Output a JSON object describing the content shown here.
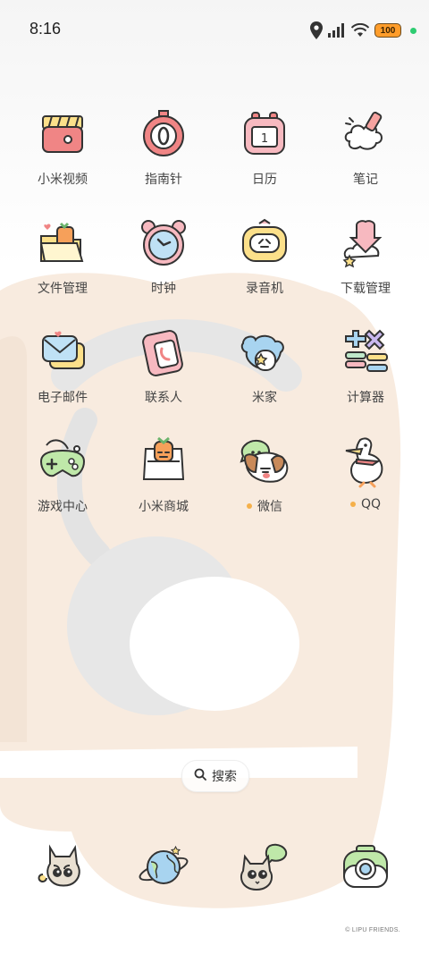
{
  "status_bar": {
    "time": "8:16",
    "battery": "100",
    "icons": [
      "location-icon",
      "signal-icon",
      "wifi-icon",
      "battery-icon",
      "camera-indicator-dot"
    ]
  },
  "apps": [
    {
      "label": "小米视频",
      "icon": "video-icon",
      "notif": false
    },
    {
      "label": "指南针",
      "icon": "compass-icon",
      "notif": false
    },
    {
      "label": "日历",
      "icon": "calendar-icon",
      "notif": false
    },
    {
      "label": "笔记",
      "icon": "notes-icon",
      "notif": false
    },
    {
      "label": "文件管理",
      "icon": "file-manager-icon",
      "notif": false
    },
    {
      "label": "时钟",
      "icon": "clock-icon",
      "notif": false
    },
    {
      "label": "录音机",
      "icon": "recorder-icon",
      "notif": false
    },
    {
      "label": "下载管理",
      "icon": "downloads-icon",
      "notif": false
    },
    {
      "label": "电子邮件",
      "icon": "email-icon",
      "notif": false
    },
    {
      "label": "联系人",
      "icon": "contacts-icon",
      "notif": false
    },
    {
      "label": "米家",
      "icon": "mi-home-icon",
      "notif": false
    },
    {
      "label": "计算器",
      "icon": "calculator-icon",
      "notif": false
    },
    {
      "label": "游戏中心",
      "icon": "game-center-icon",
      "notif": false
    },
    {
      "label": "小米商城",
      "icon": "mi-store-icon",
      "notif": false
    },
    {
      "label": "微信",
      "icon": "wechat-icon",
      "notif": true
    },
    {
      "label": "QQ",
      "icon": "qq-icon",
      "notif": true
    }
  ],
  "search": {
    "label": "搜索"
  },
  "dock": [
    {
      "icon": "phone-icon"
    },
    {
      "icon": "browser-icon"
    },
    {
      "icon": "messages-icon"
    },
    {
      "icon": "camera-icon"
    }
  ],
  "copyright": "© LIPU FRIENDS.",
  "colors": {
    "wallpaper_beige": "#f8ebdf",
    "accent_orange": "#f5b04a",
    "battery": "#ff9d2b"
  }
}
